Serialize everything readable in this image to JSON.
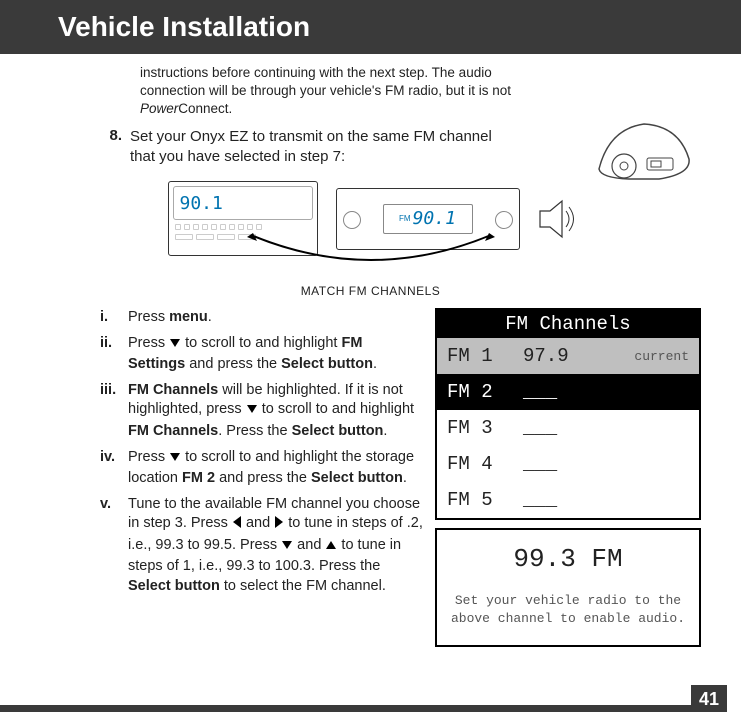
{
  "header": {
    "title": "Vehicle Installation"
  },
  "intro": {
    "line1": "instructions before continuing with the next step. The audio connection will be through your vehicle's FM radio, but it is not ",
    "powerword_italic": "Power",
    "powerword_rest": "Connect."
  },
  "step8": {
    "num": "8.",
    "text": "Set your Onyx EZ to transmit on the same FM channel that you have selected in step 7:"
  },
  "match": {
    "device_freq": "90.1",
    "radio_fm_label": "FM",
    "radio_freq": "90.1",
    "label": "MATCH FM CHANNELS"
  },
  "substeps": {
    "i": {
      "roman": "i.",
      "pre": "Press ",
      "b1": "menu",
      "post": "."
    },
    "ii": {
      "roman": "ii.",
      "pre": "Press ",
      "mid1": " to scroll to and highlight ",
      "b1": "FM Settings",
      "mid2": " and press the ",
      "b2": "Select button",
      "post": "."
    },
    "iii": {
      "roman": "iii.",
      "b1": "FM Channels",
      "mid1": " will be highlighted. If it is not highlighted, press ",
      "mid2": " to scroll to and highlight ",
      "b2": "FM Channels",
      "mid3": ". Press the ",
      "b3": "Select button",
      "post": "."
    },
    "iv": {
      "roman": "iv.",
      "pre": "Press ",
      "mid1": " to scroll to and highlight the storage location ",
      "b1": "FM 2",
      "mid2": " and press the ",
      "b2": "Select button",
      "post": "."
    },
    "v": {
      "roman": "v.",
      "pre": "Tune to the available FM channel you choose in step 3. Press ",
      "mid1": " and ",
      "mid2": " to tune in steps of .2, i.e., 99.3 to 99.5. Press ",
      "mid3": " and ",
      "mid4": " to tune in steps of 1, i.e., 99.3 to 100.3. Press the ",
      "b1": "Select button",
      "post": " to select the FM channel."
    }
  },
  "lcd": {
    "title": "FM Channels",
    "rows": [
      {
        "ch": "FM 1",
        "val": "97.9",
        "tag": "current"
      },
      {
        "ch": "FM 2",
        "val": "___"
      },
      {
        "ch": "FM 3",
        "val": "___"
      },
      {
        "ch": "FM 4",
        "val": "___"
      },
      {
        "ch": "FM 5",
        "val": "___"
      }
    ]
  },
  "lcd2": {
    "big": "99.3 FM",
    "line1": "Set your vehicle radio to the",
    "line2": "above channel to enable audio."
  },
  "page_number": "41"
}
